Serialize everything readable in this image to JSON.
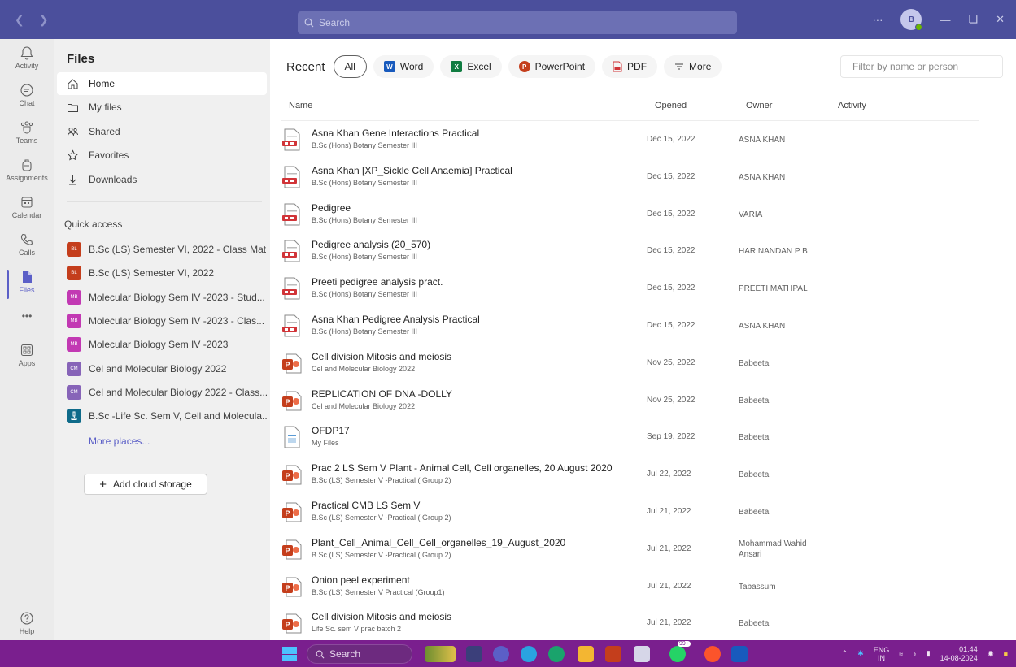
{
  "titlebar": {
    "search_placeholder": "Search",
    "more": "···",
    "avatar_initial": "B"
  },
  "rail": {
    "items": [
      {
        "label": "Activity",
        "icon": "bell-icon"
      },
      {
        "label": "Chat",
        "icon": "chat-icon"
      },
      {
        "label": "Teams",
        "icon": "teams-icon"
      },
      {
        "label": "Assignments",
        "icon": "backpack-icon"
      },
      {
        "label": "Calendar",
        "icon": "calendar-icon"
      },
      {
        "label": "Calls",
        "icon": "phone-icon"
      },
      {
        "label": "Files",
        "icon": "file-icon"
      },
      {
        "label": "Apps",
        "icon": "apps-icon"
      },
      {
        "label": "Help",
        "icon": "help-icon"
      }
    ],
    "more": "•••"
  },
  "files_panel": {
    "title": "Files",
    "nav": [
      {
        "label": "Home",
        "icon": "home-icon"
      },
      {
        "label": "My files",
        "icon": "folder-icon"
      },
      {
        "label": "Shared",
        "icon": "people-icon"
      },
      {
        "label": "Favorites",
        "icon": "star-icon"
      },
      {
        "label": "Downloads",
        "icon": "download-icon"
      }
    ],
    "quick_access_title": "Quick access",
    "quick_access": [
      {
        "label": "B.Sc (LS) Semester VI, 2022 - Class Mat...",
        "badge": "BL",
        "color": "#c43e1c"
      },
      {
        "label": "B.Sc (LS) Semester VI, 2022",
        "badge": "BL",
        "color": "#c43e1c"
      },
      {
        "label": "Molecular Biology Sem IV -2023 - Stud...",
        "badge": "MB",
        "color": "#c239b3"
      },
      {
        "label": "Molecular Biology Sem IV -2023 - Clas...",
        "badge": "MB",
        "color": "#c239b3"
      },
      {
        "label": "Molecular Biology Sem IV -2023",
        "badge": "MB",
        "color": "#c239b3"
      },
      {
        "label": "Cel and Molecular Biology 2022",
        "badge": "CM",
        "color": "#8764b8"
      },
      {
        "label": "Cel and Molecular Biology 2022 - Class...",
        "badge": "CM",
        "color": "#8764b8"
      },
      {
        "label": "B.Sc -Life Sc. Sem V, Cell and Molecula...",
        "badge": "",
        "color": "#0f6b8a"
      }
    ],
    "more_places": "More places...",
    "add_cloud": "Add cloud storage"
  },
  "main": {
    "recent_label": "Recent",
    "filters": [
      {
        "label": "All",
        "icon": "",
        "color": ""
      },
      {
        "label": "Word",
        "icon": "W",
        "color": "#185abd"
      },
      {
        "label": "Excel",
        "icon": "X",
        "color": "#107c41"
      },
      {
        "label": "PowerPoint",
        "icon": "P",
        "color": "#c43e1c"
      },
      {
        "label": "PDF",
        "icon": "pdf-icon",
        "color": "#d13438"
      },
      {
        "label": "More",
        "icon": "filter-icon",
        "color": ""
      }
    ],
    "filter_placeholder": "Filter by name or person",
    "columns": {
      "name": "Name",
      "opened": "Opened",
      "owner": "Owner",
      "activity": "Activity"
    },
    "files": [
      {
        "name": "Asna Khan Gene Interactions Practical",
        "location": "B.Sc (Hons) Botany Semester III",
        "opened": "Dec 15, 2022",
        "owner": "ASNA KHAN",
        "type": "form"
      },
      {
        "name": "Asna Khan [XP_Sickle Cell Anaemia] Practical",
        "location": "B.Sc (Hons) Botany Semester III",
        "opened": "Dec 15, 2022",
        "owner": "ASNA KHAN",
        "type": "form"
      },
      {
        "name": "Pedigree",
        "location": "B.Sc (Hons) Botany Semester III",
        "opened": "Dec 15, 2022",
        "owner": "VARIA",
        "type": "form"
      },
      {
        "name": "Pedigree analysis (20_570)",
        "location": "B.Sc (Hons) Botany Semester III",
        "opened": "Dec 15, 2022",
        "owner": "HARINANDAN P B",
        "type": "form"
      },
      {
        "name": "Preeti pedigree analysis pract.",
        "location": "B.Sc (Hons) Botany Semester III",
        "opened": "Dec 15, 2022",
        "owner": "PREETI MATHPAL",
        "type": "form"
      },
      {
        "name": "Asna Khan Pedigree Analysis Practical",
        "location": "B.Sc (Hons) Botany Semester III",
        "opened": "Dec 15, 2022",
        "owner": "ASNA KHAN",
        "type": "form"
      },
      {
        "name": "Cell division Mitosis and meiosis",
        "location": "Cel and Molecular Biology 2022",
        "opened": "Nov 25, 2022",
        "owner": "Babeeta",
        "type": "ppt"
      },
      {
        "name": "REPLICATION OF DNA -DOLLY",
        "location": "Cel and Molecular Biology 2022",
        "opened": "Nov 25, 2022",
        "owner": "Babeeta",
        "type": "ppt"
      },
      {
        "name": "OFDP17",
        "location": "My Files",
        "opened": "Sep 19, 2022",
        "owner": "Babeeta",
        "type": "generic"
      },
      {
        "name": "Prac 2 LS Sem V Plant - Animal Cell, Cell organelles, 20 August 2020",
        "location": "B.Sc (LS) Semester V -Practical ( Group 2)",
        "opened": "Jul 22, 2022",
        "owner": "Babeeta",
        "type": "ppt"
      },
      {
        "name": "Practical CMB LS Sem V",
        "location": "B.Sc (LS) Semester V -Practical ( Group 2)",
        "opened": "Jul 21, 2022",
        "owner": "Babeeta",
        "type": "ppt"
      },
      {
        "name": "Plant_Cell_Animal_Cell_Cell_organelles_19_August_2020",
        "location": "B.Sc (LS) Semester V -Practical ( Group 2)",
        "opened": "Jul 21, 2022",
        "owner": "Mohammad Wahid Ansari",
        "type": "ppt"
      },
      {
        "name": "Onion peel experiment",
        "location": "B.Sc (LS) Semester V Practical (Group1)",
        "opened": "Jul 21, 2022",
        "owner": "Tabassum",
        "type": "ppt"
      },
      {
        "name": "Cell division Mitosis and meiosis",
        "location": "Life Sc. sem V prac batch 2",
        "opened": "Jul 21, 2022",
        "owner": "Babeeta",
        "type": "ppt"
      }
    ]
  },
  "taskbar": {
    "search_label": "Search",
    "lang_top": "ENG",
    "lang_bottom": "IN",
    "time": "01:44",
    "date": "14-08-2024",
    "badge": "99+"
  }
}
